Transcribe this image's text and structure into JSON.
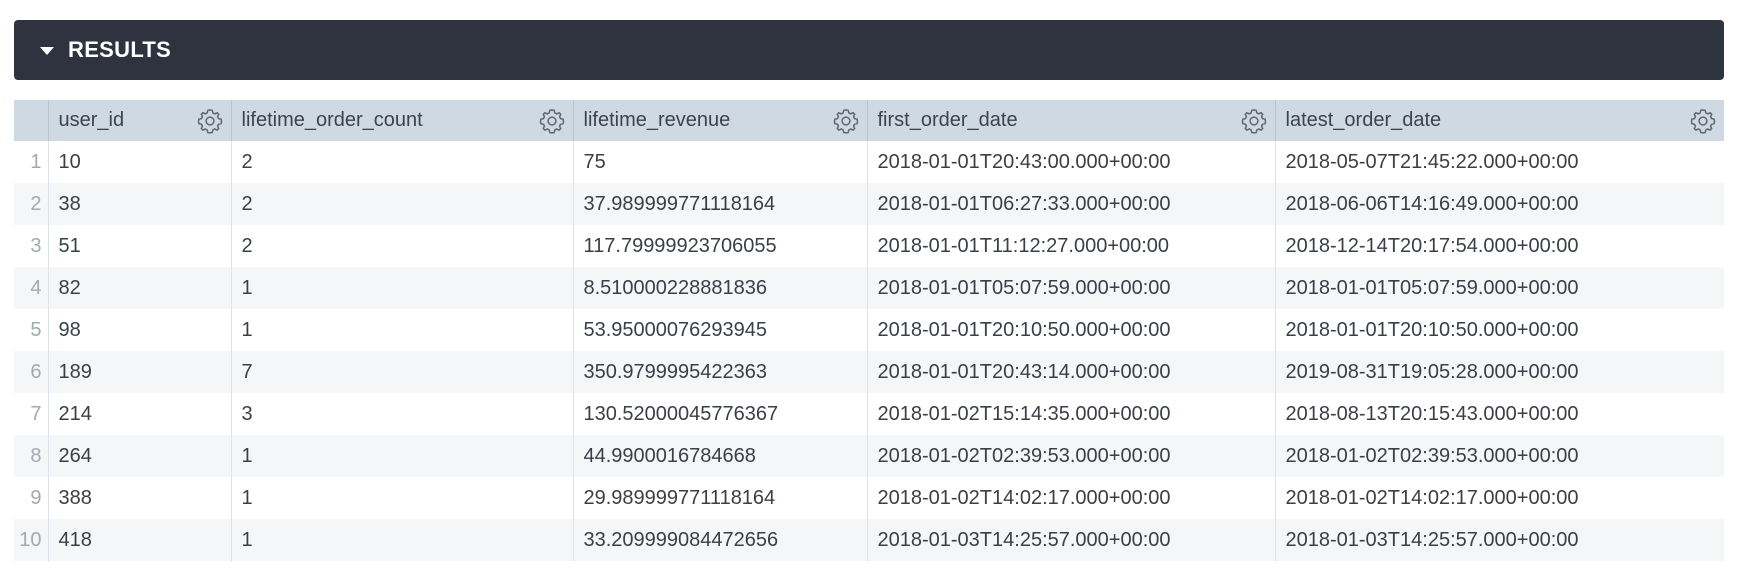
{
  "results": {
    "title": "RESULTS"
  },
  "table": {
    "columns": [
      {
        "label": "user_id"
      },
      {
        "label": "lifetime_order_count"
      },
      {
        "label": "lifetime_revenue"
      },
      {
        "label": "first_order_date"
      },
      {
        "label": "latest_order_date"
      }
    ],
    "rows": [
      {
        "num": "1",
        "cells": [
          "10",
          "2",
          "75",
          "2018-01-01T20:43:00.000+00:00",
          "2018-05-07T21:45:22.000+00:00"
        ]
      },
      {
        "num": "2",
        "cells": [
          "38",
          "2",
          "37.989999771118164",
          "2018-01-01T06:27:33.000+00:00",
          "2018-06-06T14:16:49.000+00:00"
        ]
      },
      {
        "num": "3",
        "cells": [
          "51",
          "2",
          "117.79999923706055",
          "2018-01-01T11:12:27.000+00:00",
          "2018-12-14T20:17:54.000+00:00"
        ]
      },
      {
        "num": "4",
        "cells": [
          "82",
          "1",
          "8.510000228881836",
          "2018-01-01T05:07:59.000+00:00",
          "2018-01-01T05:07:59.000+00:00"
        ]
      },
      {
        "num": "5",
        "cells": [
          "98",
          "1",
          "53.95000076293945",
          "2018-01-01T20:10:50.000+00:00",
          "2018-01-01T20:10:50.000+00:00"
        ]
      },
      {
        "num": "6",
        "cells": [
          "189",
          "7",
          "350.9799995422363",
          "2018-01-01T20:43:14.000+00:00",
          "2019-08-31T19:05:28.000+00:00"
        ]
      },
      {
        "num": "7",
        "cells": [
          "214",
          "3",
          "130.52000045776367",
          "2018-01-02T15:14:35.000+00:00",
          "2018-08-13T20:15:43.000+00:00"
        ]
      },
      {
        "num": "8",
        "cells": [
          "264",
          "1",
          "44.9900016784668",
          "2018-01-02T02:39:53.000+00:00",
          "2018-01-02T02:39:53.000+00:00"
        ]
      },
      {
        "num": "9",
        "cells": [
          "388",
          "1",
          "29.989999771118164",
          "2018-01-02T14:02:17.000+00:00",
          "2018-01-02T14:02:17.000+00:00"
        ]
      },
      {
        "num": "10",
        "cells": [
          "418",
          "1",
          "33.209999084472656",
          "2018-01-03T14:25:57.000+00:00",
          "2018-01-03T14:25:57.000+00:00"
        ]
      }
    ]
  },
  "icons": {
    "toggle": "caret-down-icon",
    "column_settings": "gear-icon"
  },
  "colors": {
    "header_bar": "#2f3340",
    "column_header": "#cfd9e3"
  }
}
